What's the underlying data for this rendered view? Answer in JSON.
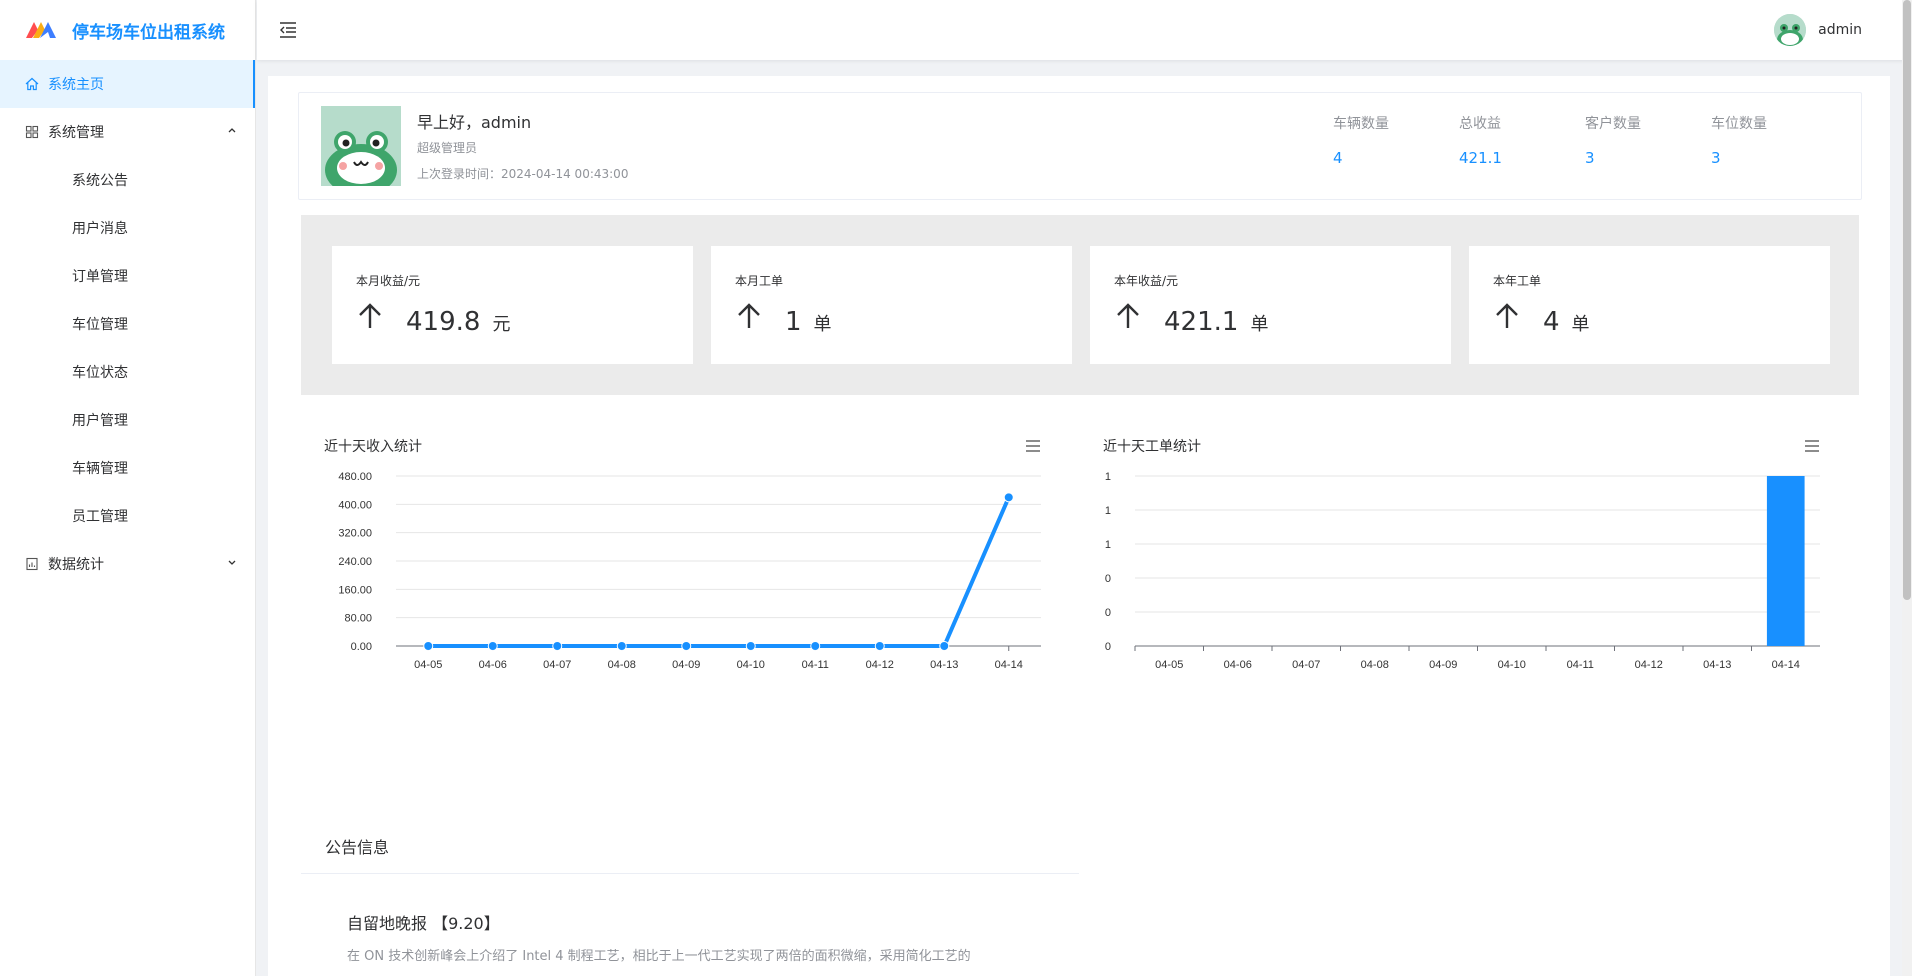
{
  "app": {
    "title": "停车场车位出租系统",
    "brand_colors": [
      "#3d7eff",
      "#ff4d4f",
      "#faad14"
    ]
  },
  "sidebar": {
    "items": [
      {
        "label": "系统主页",
        "icon": "home-icon",
        "active": true
      },
      {
        "label": "系统管理",
        "icon": "grid-icon",
        "expanded": true
      },
      {
        "label": "系统公告"
      },
      {
        "label": "用户消息"
      },
      {
        "label": "订单管理"
      },
      {
        "label": "车位管理"
      },
      {
        "label": "车位状态"
      },
      {
        "label": "用户管理"
      },
      {
        "label": "车辆管理"
      },
      {
        "label": "员工管理"
      },
      {
        "label": "数据统计",
        "icon": "document-chart-icon",
        "expanded": false
      }
    ]
  },
  "header": {
    "username": "admin"
  },
  "welcome": {
    "greeting": "早上好，admin",
    "role": "超级管理员",
    "last_login": "上次登录时间：2024-04-14 00:43:00",
    "stats": [
      {
        "label": "车辆数量",
        "value": "4"
      },
      {
        "label": "总收益",
        "value": "421.1"
      },
      {
        "label": "客户数量",
        "value": "3"
      },
      {
        "label": "车位数量",
        "value": "3"
      }
    ]
  },
  "cards": [
    {
      "title": "本月收益/元",
      "value": "419.8",
      "unit": "元"
    },
    {
      "title": "本月工单",
      "value": "1",
      "unit": "单"
    },
    {
      "title": "本年收益/元",
      "value": "421.1",
      "unit": "单"
    },
    {
      "title": "本年工单",
      "value": "4",
      "unit": "单"
    }
  ],
  "chart_data": [
    {
      "type": "line",
      "title": "近十天收入统计",
      "color": "#1890ff",
      "categories": [
        "04-05",
        "04-06",
        "04-07",
        "04-08",
        "04-09",
        "04-10",
        "04-11",
        "04-12",
        "04-13",
        "04-14"
      ],
      "values": [
        0,
        0,
        0,
        0,
        0,
        0,
        0,
        0,
        0,
        419.8
      ],
      "yticks": [
        "0.00",
        "80.00",
        "160.00",
        "240.00",
        "320.00",
        "400.00",
        "480.00"
      ],
      "ylim": [
        0,
        480
      ]
    },
    {
      "type": "bar",
      "title": "近十天工单统计",
      "color": "#1890ff",
      "categories": [
        "04-05",
        "04-06",
        "04-07",
        "04-08",
        "04-09",
        "04-10",
        "04-11",
        "04-12",
        "04-13",
        "04-14"
      ],
      "values": [
        0,
        0,
        0,
        0,
        0,
        0,
        0,
        0,
        0,
        1
      ],
      "yticks": [
        "0",
        "0",
        "0",
        "1",
        "1",
        "1"
      ],
      "ylim": [
        0,
        1
      ]
    }
  ],
  "notice": {
    "section_title": "公告信息",
    "item_title": "自留地晚报 【9.20】",
    "item_body": "在 ON 技术创新峰会上介绍了 Intel 4 制程工艺，相比于上一代工艺实现了两倍的面积微缩，采用简化工艺的"
  }
}
